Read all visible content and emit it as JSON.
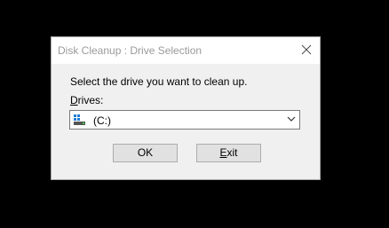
{
  "window": {
    "title": "Disk Cleanup : Drive Selection"
  },
  "prompt_text": "Select the drive you want to clean up.",
  "drives": {
    "label_mnemonic": "D",
    "label_rest": "rives:",
    "selected_value": "(C:)",
    "icon": "hard-drive-icon"
  },
  "buttons": {
    "ok_label": "OK",
    "exit_mnemonic": "E",
    "exit_rest": "xit"
  },
  "colors": {
    "background": "#000000",
    "dialog_body": "#f0f0f0",
    "title_text": "#9a9a9a",
    "button_face": "#e1e1e1",
    "drive_icon_accent": "#1e7ed6",
    "drive_icon_body": "#555555"
  }
}
